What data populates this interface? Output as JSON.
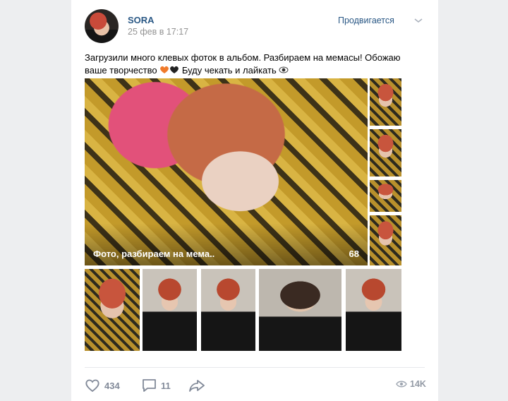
{
  "post": {
    "author": "SORA",
    "date": "25 фев в 17:17",
    "promo_label": "Продвигается",
    "text_line1": "Загрузили много клевых фоток в альбом. Разбираем на мемасы! Обожаю",
    "text_line2_a": "ваше творчество",
    "text_line2_b": "Буду чекать и лайкать",
    "album": {
      "title": "Фото, разбираем на мема..",
      "count": "68"
    }
  },
  "footer": {
    "likes": "434",
    "comments": "11",
    "views": "14K"
  },
  "icons": [
    "chevron-down-icon",
    "orange-heart-icon",
    "black-heart-icon",
    "eye-emoji-icon",
    "like-heart-icon",
    "comment-icon",
    "share-icon",
    "views-eye-icon"
  ],
  "colors": {
    "link": "#2a5885",
    "muted": "#939393",
    "action": "#828a99",
    "background": "#edeef0"
  }
}
